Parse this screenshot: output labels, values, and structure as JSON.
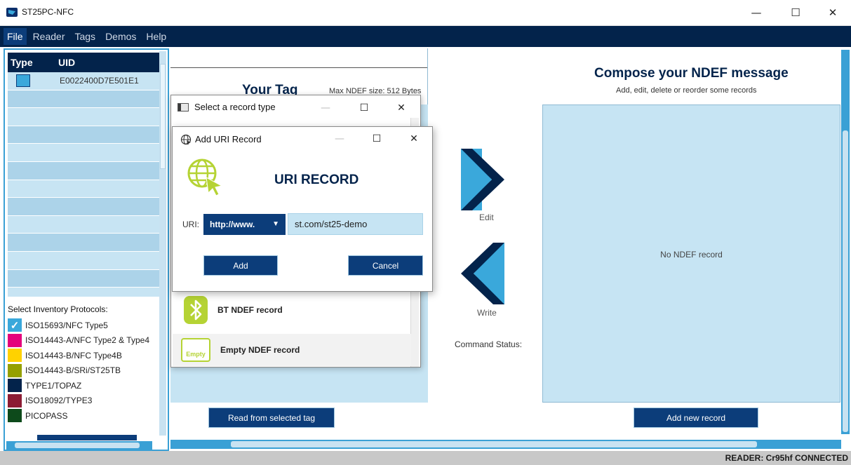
{
  "window": {
    "title": "ST25PC-NFC",
    "minimize": "—",
    "maximize": "☐",
    "close": "✕"
  },
  "menu": [
    "File",
    "Reader",
    "Tags",
    "Demos",
    "Help"
  ],
  "tag_table": {
    "headers": [
      "Type",
      "UID"
    ],
    "rows": [
      {
        "uid": "E0022400D7E501E1"
      }
    ]
  },
  "protocols": {
    "title": "Select Inventory Protocols:",
    "items": [
      {
        "label": "ISO15693/NFC Type5",
        "color": "#3aa8db",
        "checked": true
      },
      {
        "label": "ISO14443-A/NFC Type2 & Type4",
        "color": "#e4007c",
        "checked": false
      },
      {
        "label": "ISO14443-B/NFC Type4B",
        "color": "#ffd200",
        "checked": false
      },
      {
        "label": "ISO14443-B/SRi/ST25TB",
        "color": "#95a000",
        "checked": false
      },
      {
        "label": "TYPE1/TOPAZ",
        "color": "#03234b",
        "checked": false
      },
      {
        "label": "ISO18092/TYPE3",
        "color": "#8c1c34",
        "checked": false
      },
      {
        "label": "PICOPASS",
        "color": "#0d4a1b",
        "checked": false
      }
    ]
  },
  "your_tag": {
    "title": "Your Tag",
    "max_ndef": "Max NDEF size: 512 Bytes",
    "read_button": "Read from selected tag"
  },
  "actions": {
    "edit": "Edit",
    "write": "Write",
    "command_status": "Command Status:"
  },
  "compose": {
    "title": "Compose your NDEF message",
    "subtitle": "Add, edit, delete or reorder some records",
    "empty": "No NDEF record",
    "add_button": "Add new record"
  },
  "select_record_window": {
    "title": "Select a record type",
    "items": [
      {
        "label": "BT NDEF record",
        "icon": "bluetooth-icon"
      },
      {
        "label": "Empty NDEF record",
        "icon": "empty-icon",
        "icon_text": "Empty"
      }
    ]
  },
  "uri_window": {
    "title": "Add URI Record",
    "heading": "URI RECORD",
    "uri_label": "URI:",
    "prefix_selected": "http://www.",
    "uri_value": "st.com/st25-demo",
    "add_button": "Add",
    "cancel_button": "Cancel"
  },
  "status": {
    "reader": "READER: Cr95hf CONNECTED"
  },
  "colors": {
    "navy": "#03234b",
    "accent_blue": "#3aa8db",
    "light_blue": "#c6e4f3",
    "lime": "#b5d334"
  }
}
